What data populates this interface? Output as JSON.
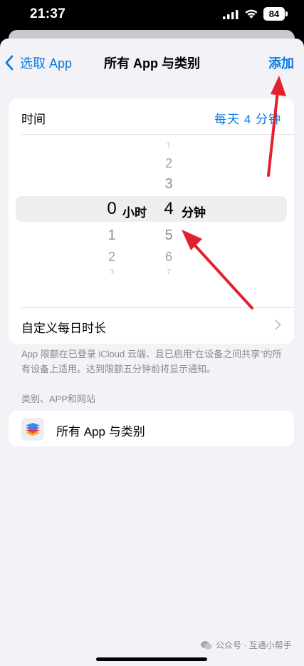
{
  "status_bar": {
    "time": "21:37",
    "battery": "84"
  },
  "nav": {
    "back_label": "选取 App",
    "title": "所有 App 与类别",
    "add_label": "添加"
  },
  "time_row": {
    "label": "时间",
    "value": "每天 4 分钟"
  },
  "picker": {
    "hours": {
      "above": [
        "",
        "",
        ""
      ],
      "selected": "0",
      "below": [
        "1",
        "2",
        "3"
      ],
      "unit": "小时"
    },
    "minutes": {
      "above": [
        "1",
        "2",
        "3"
      ],
      "selected": "4",
      "below": [
        "5",
        "6",
        "7"
      ],
      "unit": "分钟"
    }
  },
  "custom_row": {
    "label": "自定义每日时长"
  },
  "footnote": "App 限额在已登录 iCloud 云端、且已启用“在设备之间共享”的所有设备上适用。达到限额五分钟前将显示通知。",
  "section_header": "类别、APP和网站",
  "app_row": {
    "label": "所有 App 与类别",
    "icon": "layers-stack-icon"
  },
  "watermark": "公众号 · 互通小帮手",
  "colors": {
    "accent": "#0a7ae0",
    "annotation": "#e3202f",
    "background": "#f2f2f7"
  }
}
